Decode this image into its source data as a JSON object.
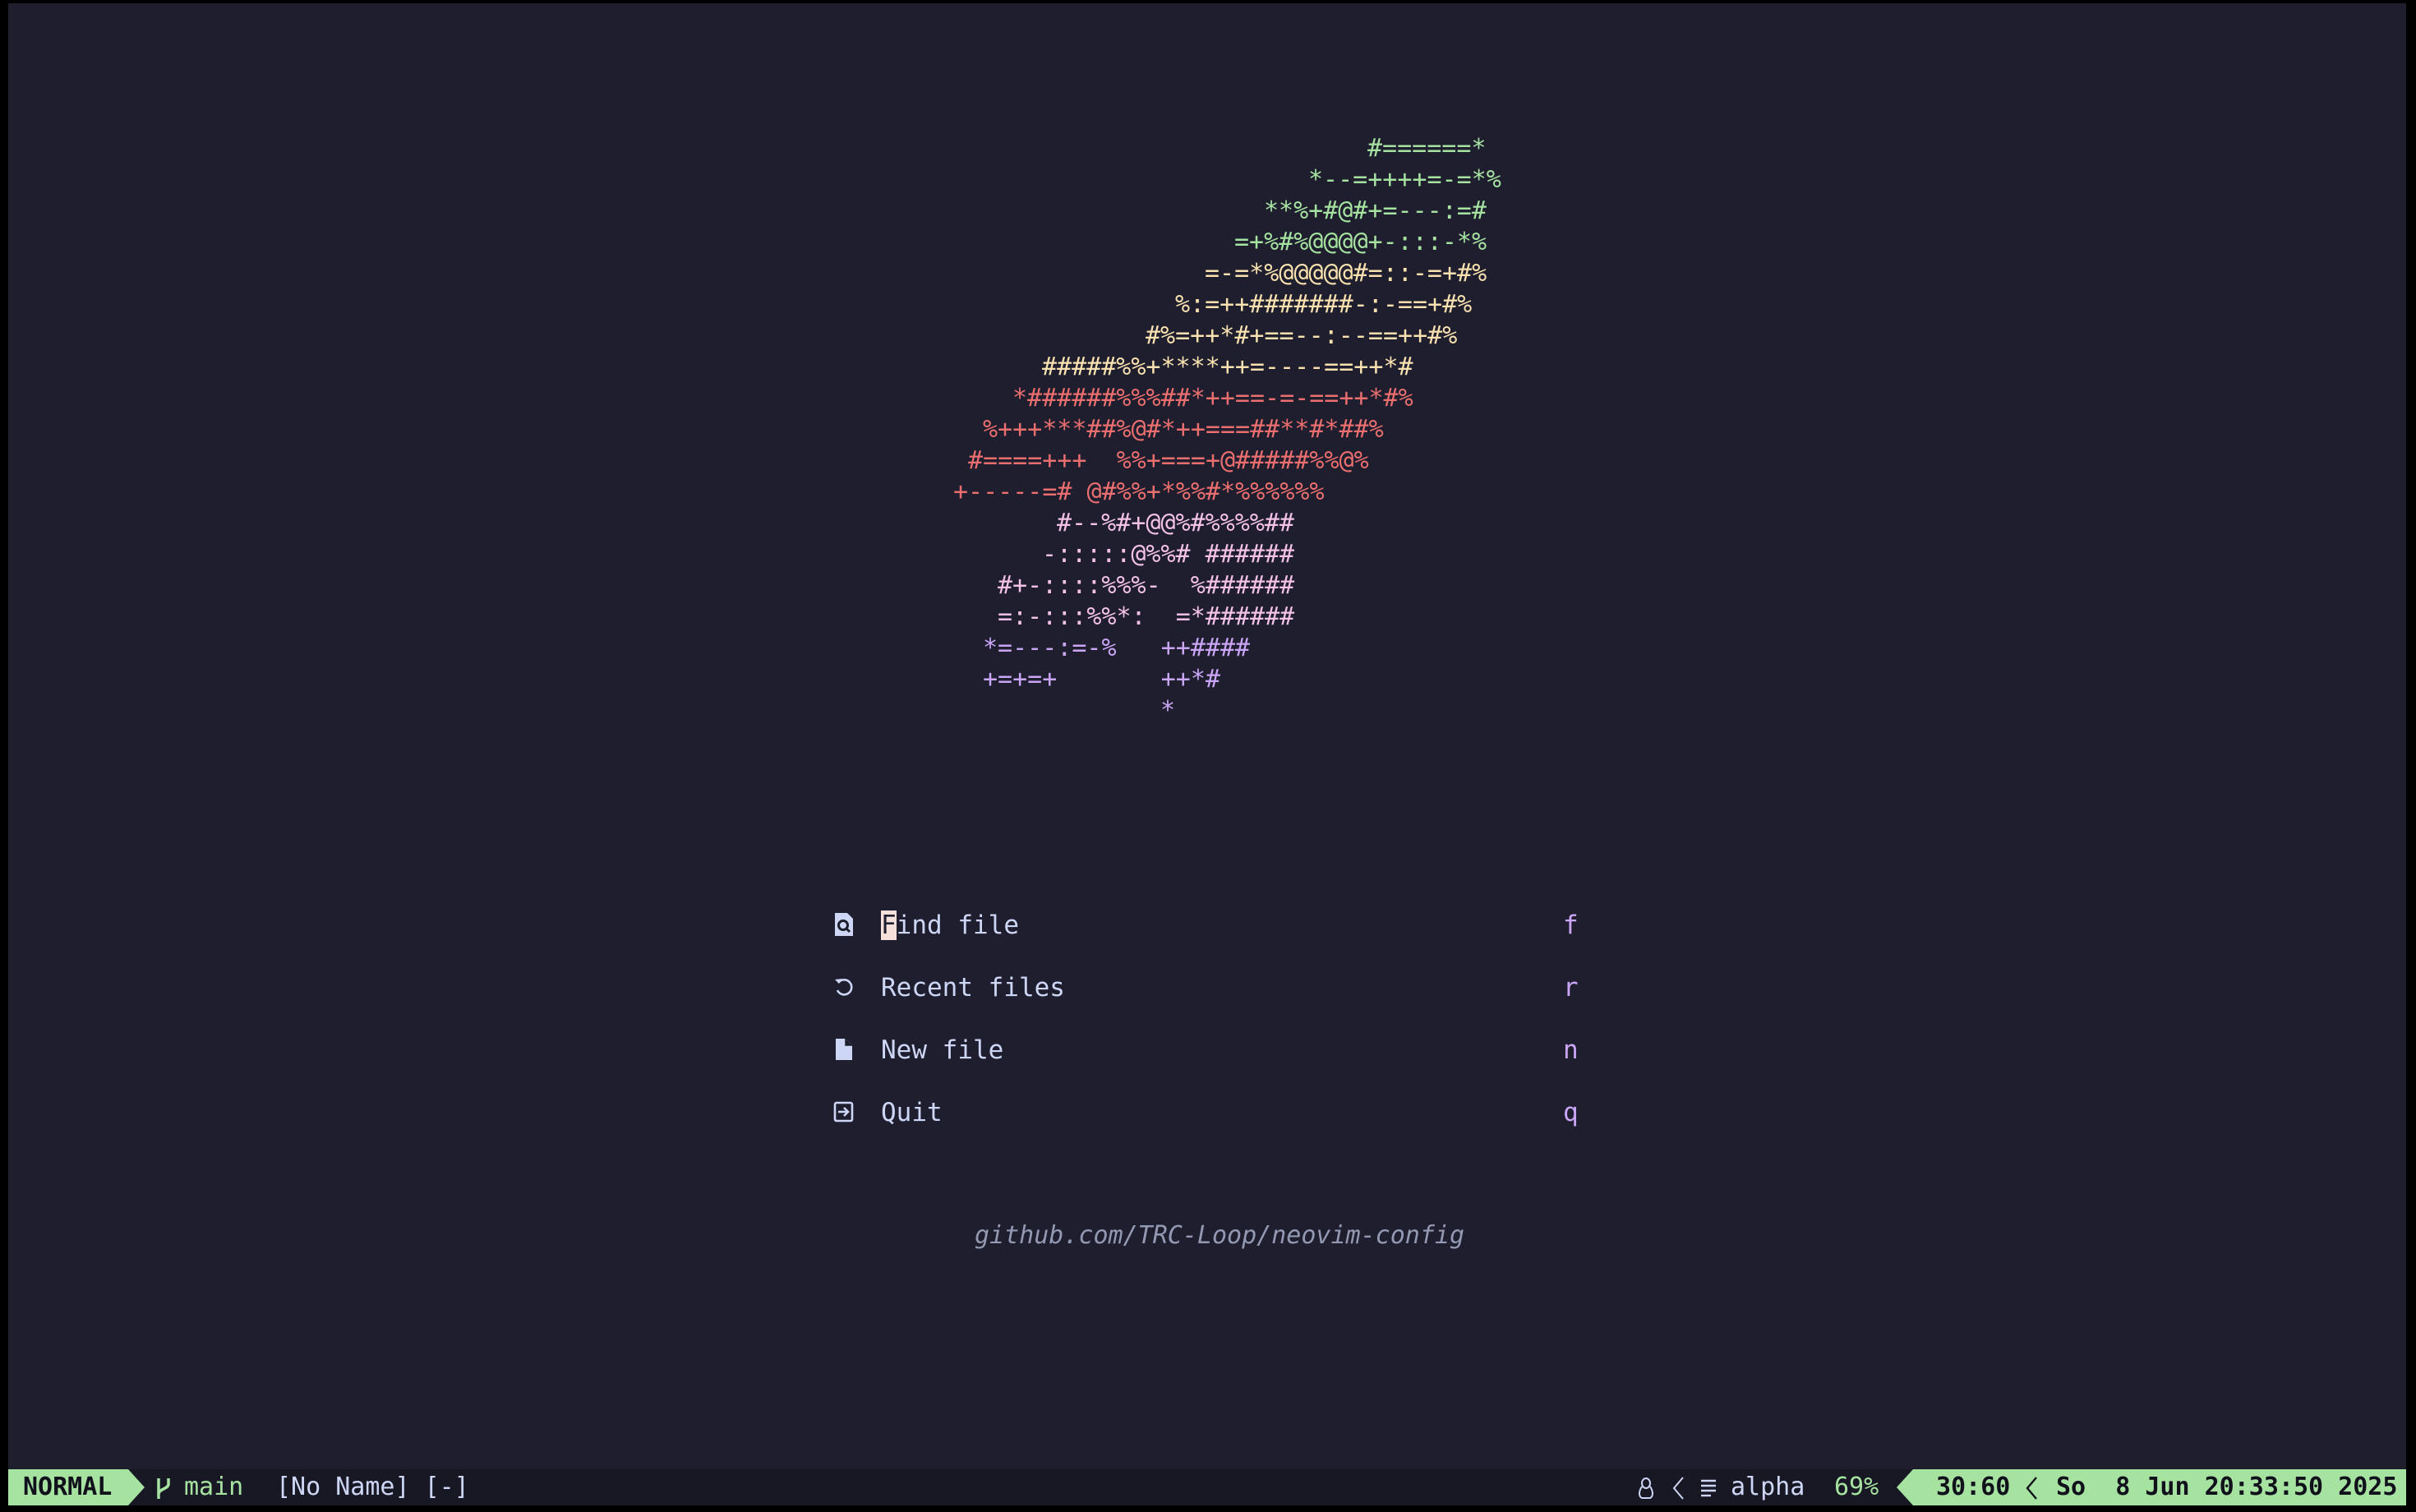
{
  "colors": {
    "background": "#1e1e2e",
    "green": "#a6e3a1",
    "yellow": "#f9e2af",
    "red": "#f38ba8",
    "salmon": "#eb6f6f",
    "pink": "#f5c2e7",
    "mauve": "#cba6f7",
    "text": "#cdd6f4"
  },
  "header_art": [
    {
      "text": "#======*",
      "color": "#a6e3a1"
    },
    {
      "text": "*--=++++=-=*%",
      "color": "#a6e3a1"
    },
    {
      "text": "**%+#@#+=---:=#",
      "color": "#a6e3a1"
    },
    {
      "text": "=+%#%@@@@+-:::-*%",
      "color": "#a6e3a1"
    },
    {
      "text": "=-=*%@@@@@#=::-=+#%",
      "color": "#f9e2af"
    },
    {
      "text": "%:=++#######-:-==+#%",
      "color": "#f9e2af"
    },
    {
      "text": "#%=++*#+==--:--==++#%",
      "color": "#f9e2af"
    },
    {
      "text": "#####%%+****++=----==++*#",
      "color": "#f9e2af"
    },
    {
      "text": "*######%%%##*++==-=-==++*#%",
      "color": "#eb6f6f"
    },
    {
      "text": "%+++***##%@#*++===##**#*##%",
      "color": "#eb6f6f"
    },
    {
      "text": "#====+++  %%+===+@#####%%@%",
      "color": "#eb6f6f"
    },
    {
      "text": "+-----=# @#%%+*%%#*%%%%%%",
      "color": "#eb6f6f"
    },
    {
      "text": "#--%#+@@%#%%%%##",
      "color": "#f5c2e7"
    },
    {
      "text": "-:::::@%%# ######",
      "color": "#f5c2e7"
    },
    {
      "text": "#+-::::%%%-  %######",
      "color": "#f5c2e7"
    },
    {
      "text": "=:-:::%%*:  =*######",
      "color": "#f5c2e7"
    },
    {
      "text": "*=---:=-%   ++####",
      "color": "#cba6f7"
    },
    {
      "text": "+=+=+       ++*#",
      "color": "#cba6f7"
    },
    {
      "text": "*",
      "color": "#cba6f7"
    }
  ],
  "menu": [
    {
      "icon": "find-file-icon",
      "label_first": "F",
      "label_rest": "ind file",
      "key": "f"
    },
    {
      "icon": "history-icon",
      "label_first": "",
      "label_rest": "Recent files",
      "key": "r"
    },
    {
      "icon": "new-file-icon",
      "label_first": "",
      "label_rest": "New file",
      "key": "n"
    },
    {
      "icon": "quit-icon",
      "label_first": "",
      "label_rest": "Quit",
      "key": "q"
    }
  ],
  "footer": "github.com/TRC-Loop/neovim-config",
  "statusline": {
    "mode": "NORMAL",
    "branch": "main",
    "filename": "[No Name] [-]",
    "filetype": "alpha",
    "progress": "69%",
    "location": "30:60",
    "datetime": "So  8 Jun 20:33:50 2025"
  }
}
